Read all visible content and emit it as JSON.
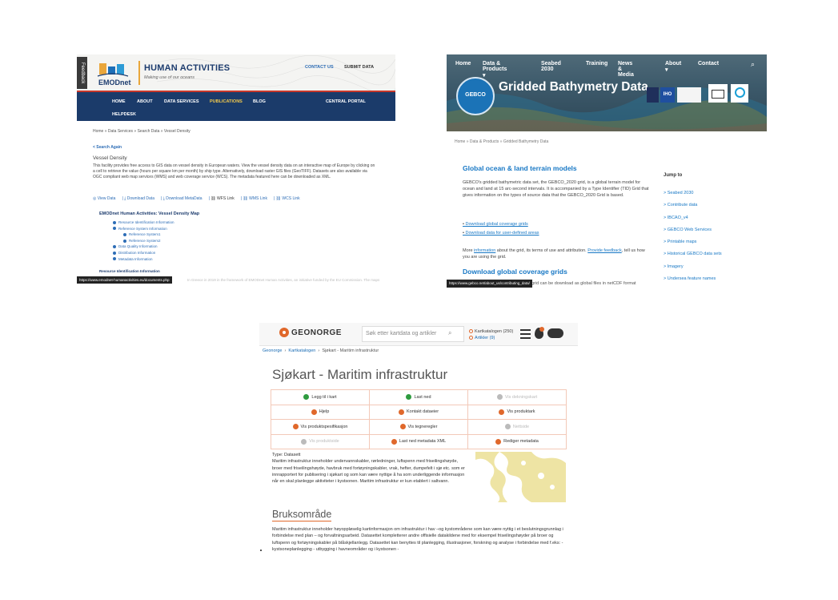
{
  "emodnet": {
    "feedback": "Feedback",
    "logo_text": "EMODnet",
    "title": "HUMAN ACTIVITIES",
    "tagline": "Making use of our oceans",
    "contact": "CONTACT US",
    "submit": "SUBMIT DATA",
    "nav": [
      "HOME",
      "ABOUT",
      "DATA SERVICES",
      "PUBLICATIONS",
      "BLOG",
      "CENTRAL PORTAL",
      "HELPDESK"
    ],
    "breadcrumb": "Home » Data Services » Search Data » Vessel Density",
    "search_again": "< Search Again",
    "heading": "Vessel Density",
    "description": "This facility provides free access to GIS data on vessel density in European waters. View the vessel density data on an interactive map of Europe by clicking on a cell to retrieve the value (hours per square km per month) by ship type. Alternatively, download raster GIS files (GeoTIFF). Datasets are also available via OGC compliant web map services (WMS) and web coverage service (WCS). The metadata featured here can be downloaded as XML.",
    "links": [
      "View Data",
      "Download Data",
      "Download MetaData",
      "WFS Link",
      "WMS Link",
      "WCS Link"
    ],
    "tree_title": "EMODnet Human Activities: Vessel Density Map",
    "tree": [
      "Resource Identification Information",
      "Reference System Information",
      "Reference System1",
      "Reference System2",
      "Data Quality Information",
      "Distribution Information",
      "Metadata Information"
    ],
    "resource_info": "Resource Identification Information",
    "status_url": "https://www.emodnet-humanactivities.eu/documents.php",
    "faded_text": "In Greece in 2019 in the framework of EMODnet Human Activities, an initiative funded by the EU Commission. The maps"
  },
  "gebco": {
    "nav": [
      "Home",
      "Data & Products ▾",
      "Seabed 2030",
      "Training",
      "News & Media",
      "About ▾",
      "Contact"
    ],
    "badge_text": "GEBCO",
    "hero_title": "Gridded Bathymetry Data",
    "logo_iho": "IHO",
    "breadcrumb": "Home  »  Data & Products  »  Gridded Bathymetry Data",
    "h1": "Global ocean & land terrain models",
    "body": "GEBCO's gridded bathymetric data set, the GEBCO_2020 grid, is a global terrain model for ocean and land at 15 arc-second intervals. It is accompanied by a Type Identifier (TID) Grid that gives information on the types of source data that the GEBCO_2020 Grid is based.",
    "bullets": [
      "Download global coverage grids",
      "Download data for user-defined areas"
    ],
    "more_pre": "More ",
    "more_link1": "information",
    "more_mid": " about the grid, its terms of use and attribution. ",
    "more_link2": "Provide feedback",
    "more_post": ", tell us how you are using the grid.",
    "h1b": "Download global coverage grids",
    "jump_title": "Jump to",
    "jump": [
      "Seabed 2030",
      "Contribute data",
      "IBCAO_v4",
      "GEBCO Web Services",
      "Printable maps",
      "Historical GEBCO data sets",
      "Imagery",
      "Undersea feature names"
    ],
    "status_url": "https://www.gebco.net/about_us/contributing_data/",
    "tail": "grid can be download as global files in netCDF format"
  },
  "geonorge": {
    "brand": "GEONORGE",
    "search_placeholder": "Søk etter kartdata og artikler",
    "radio1": "Kartkatalogen (250)",
    "radio2": "Artikler (9)",
    "breadcrumb": [
      "Geonorge",
      "Kartkatalogen",
      "Sjøkart - Maritim infrastruktur"
    ],
    "title": "Sjøkart - Maritim infrastruktur",
    "actions": [
      {
        "label": "Legg til i kart",
        "enabled": true,
        "color": "#2e9b3f"
      },
      {
        "label": "Last ned",
        "enabled": true,
        "color": "#2e9b3f"
      },
      {
        "label": "Vis dekningskart",
        "enabled": false,
        "color": "#bbbbbb"
      },
      {
        "label": "Hjelp",
        "enabled": true,
        "color": "#e0682b"
      },
      {
        "label": "Kontakt dataeier",
        "enabled": true,
        "color": "#e0682b"
      },
      {
        "label": "Vis produktark",
        "enabled": true,
        "color": "#e0682b"
      },
      {
        "label": "Vis produktspesifikasjon",
        "enabled": true,
        "color": "#e0682b"
      },
      {
        "label": "Vis tegneregler",
        "enabled": true,
        "color": "#e0682b"
      },
      {
        "label": "Nettside",
        "enabled": false,
        "color": "#bbbbbb"
      },
      {
        "label": "Vis produktside",
        "enabled": false,
        "color": "#bbbbbb"
      },
      {
        "label": "Last ned metadata XML",
        "enabled": true,
        "color": "#e0682b"
      },
      {
        "label": "Rediger metadata",
        "enabled": true,
        "color": "#e0682b"
      }
    ],
    "type": "Type: Datasett",
    "description": "Maritim infrastruktur inneholder undervannskabler, rørledninger, luftspenn med friseilingshøyde, broer med friseilingshøyde, havbruk med fortøyningskabler, vrak, hefter, dumpefelt i sjø etc. som er innrapportert for publisering i sjøkart og som kan være nyttige å ha som underliggende informasjon når en skal planlegge aktiviteter i kystsonen. Maritim infrastruktur er kun etablert i saltvann.",
    "h2": "Bruksområde",
    "usage": "Maritim infrastruktur inneholder høyoppløselig kartinformasjon om infrastruktur i hav –og kystområdene som kan være nyttig i et beslutningsgrunnlag i forbindelse med plan – og forvaltningsarbeid. Datasettet kompletterer andre offisielle datakildene med for eksempel friseilingshøyder på broer og luftspenn og fortøyningskabler på blåskjellanlegg. Datasettet kan benyttes til planlegging, illustrasjoner, forskning og analyse i forbindelse med f.eks: - kystsoneplanlegging - utbygging i havneområder og i kystsonen -"
  }
}
